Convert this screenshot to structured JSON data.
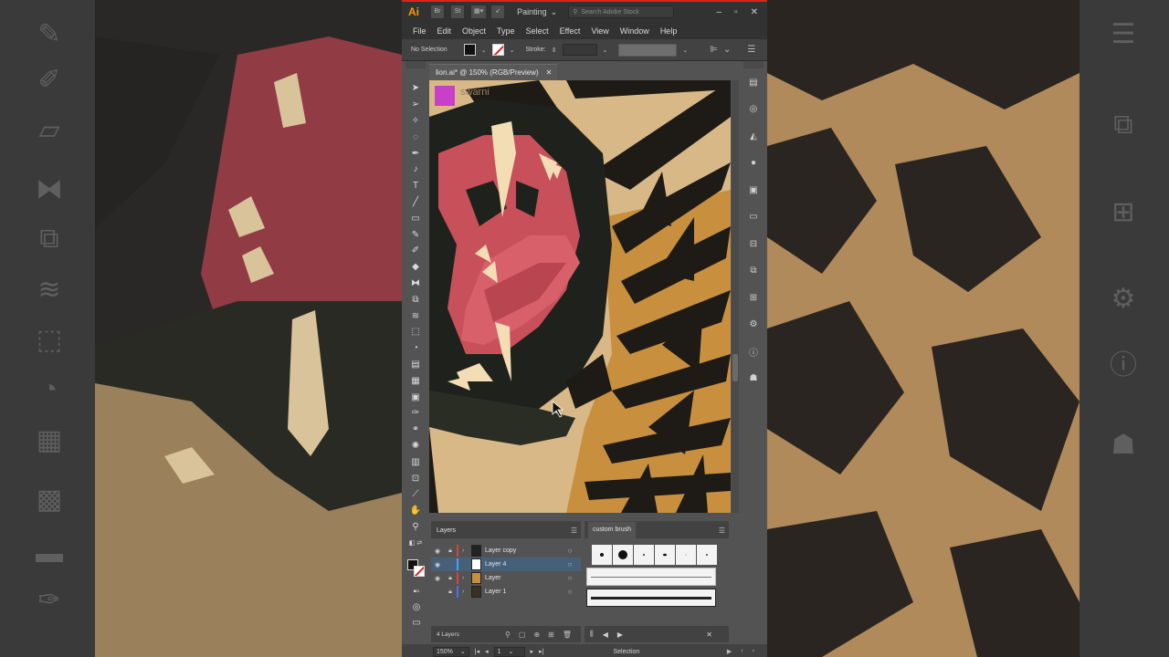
{
  "titlebar": {
    "app_logo": "Ai",
    "btn_bridge": "Br",
    "btn_stock": "St",
    "workspace": "Painting",
    "stock_search_placeholder": "Search Adobe Stock",
    "minimize_icon": "minimize-icon",
    "maximize_icon": "maximize-icon",
    "close_icon": "close-icon"
  },
  "menu": [
    "File",
    "Edit",
    "Object",
    "Type",
    "Select",
    "Effect",
    "View",
    "Window",
    "Help"
  ],
  "controlbar": {
    "selection_label": "No Selection",
    "stroke_label": "Stroke:"
  },
  "document": {
    "tab_label": "lion.ai* @ 150% (RGB/Preview)",
    "watermark": "swarni"
  },
  "layers_panel": {
    "title": "Layers",
    "layers": [
      {
        "name": "Layer copy",
        "visible": true,
        "locked": true,
        "color": "#e04040",
        "selected": false
      },
      {
        "name": "Layer 4",
        "visible": true,
        "locked": false,
        "color": "#4aa0ff",
        "selected": true
      },
      {
        "name": "Layer",
        "visible": true,
        "locked": true,
        "color": "#e04040",
        "selected": false
      },
      {
        "name": "Layer 1",
        "visible": false,
        "locked": true,
        "color": "#4a6cff",
        "selected": false
      }
    ],
    "count_label": "4 Layers"
  },
  "brush_panel": {
    "title": "custom brush"
  },
  "statusbar": {
    "zoom": "150%",
    "artboard": "1",
    "status": "Selection"
  },
  "colors": {
    "accent_red": "#e02020",
    "ai_orange": "#ff9a00",
    "lion_fur": "#d8b887",
    "lion_mouth": "#c8505a",
    "lion_teeth": "#f3ddb4"
  }
}
